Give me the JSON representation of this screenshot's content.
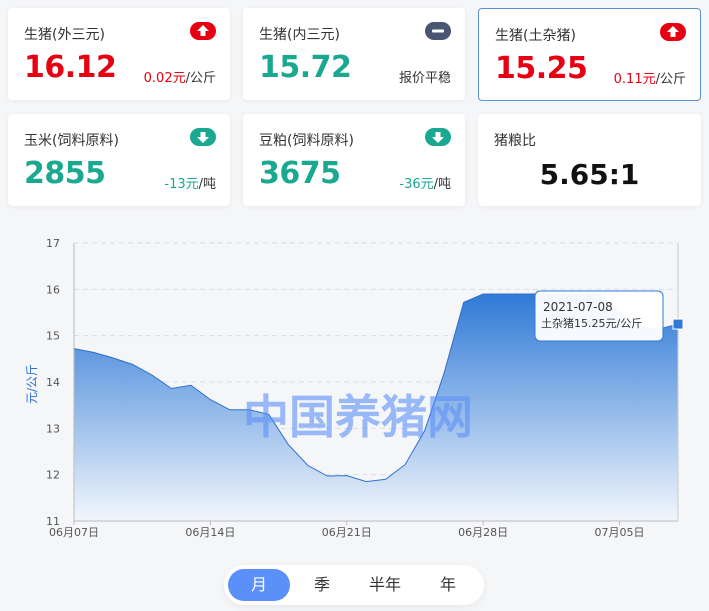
{
  "cards": [
    {
      "label": "生猪(外三元)",
      "price": "16.12",
      "change": "0.02元",
      "unit": "/公斤",
      "trend": "up-arrow-icon"
    },
    {
      "label": "生猪(内三元)",
      "price": "15.72",
      "change": "",
      "unit": "报价平稳",
      "trend": "minus-icon"
    },
    {
      "label": "生猪(土杂猪)",
      "price": "15.25",
      "change": "0.11元",
      "unit": "/公斤",
      "trend": "up-arrow-icon"
    },
    {
      "label": "玉米(饲料原料)",
      "price": "2855",
      "change": "-13元",
      "unit": "/吨",
      "trend": "down-arrow-icon"
    },
    {
      "label": "豆粕(饲料原料)",
      "price": "3675",
      "change": "-36元",
      "unit": "/吨",
      "trend": "down-arrow-icon"
    },
    {
      "label": "猪粮比",
      "value": "5.65:1"
    }
  ],
  "colors": {
    "up": "#e60012",
    "down": "#1aa890",
    "flat": "#4a5572",
    "accent": "#5b8ff9"
  },
  "tabs": [
    "月",
    "季",
    "半年",
    "年"
  ],
  "active_tab": "月",
  "watermark": "中国养猪网",
  "chart_data": {
    "type": "area",
    "ylabel": "元/公斤",
    "ylim": [
      11,
      17
    ],
    "yticks": [
      "11",
      "12",
      "13",
      "14",
      "15",
      "16",
      "17"
    ],
    "xticks": [
      "06月07日",
      "06月14日",
      "06月21日",
      "06月28日",
      "07月05日"
    ],
    "x": [
      "06-07",
      "06-08",
      "06-09",
      "06-10",
      "06-11",
      "06-12",
      "06-13",
      "06-14",
      "06-15",
      "06-16",
      "06-17",
      "06-18",
      "06-19",
      "06-20",
      "06-21",
      "06-22",
      "06-23",
      "06-24",
      "06-25",
      "06-26",
      "06-27",
      "06-28",
      "06-29",
      "06-30",
      "07-01",
      "07-02",
      "07-03",
      "07-04",
      "07-05",
      "07-06",
      "07-07",
      "07-08"
    ],
    "values": [
      14.72,
      14.64,
      14.52,
      14.38,
      14.15,
      13.86,
      13.93,
      13.62,
      13.4,
      13.4,
      13.3,
      12.65,
      12.2,
      11.97,
      11.98,
      11.85,
      11.9,
      12.22,
      12.95,
      14.2,
      15.72,
      15.9,
      15.9,
      15.9,
      15.9,
      15.9,
      15.9,
      15.9,
      15.5,
      15.2,
      15.14,
      15.25
    ],
    "tooltip": {
      "date": "2021-07-08",
      "text": "土杂猪15.25元/公斤"
    },
    "grid": true
  }
}
